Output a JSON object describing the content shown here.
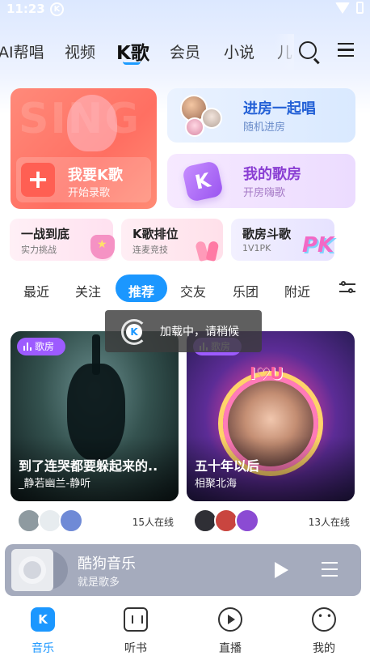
{
  "status": {
    "time": "11:23",
    "app_badge": "K"
  },
  "topnav": {
    "tabs": [
      "AI帮唱",
      "视频",
      "K歌",
      "会员",
      "小说",
      "儿"
    ],
    "active": "K歌"
  },
  "entry": {
    "sing": {
      "deco": "SING",
      "title": "我要K歌",
      "subtitle": "开始录歌"
    },
    "join_room": {
      "title": "进房一起唱",
      "subtitle": "随机进房"
    },
    "my_room": {
      "badge": "K",
      "title": "我的歌房",
      "subtitle": "开房嗨歌"
    }
  },
  "mini_cards": [
    {
      "title": "一战到底",
      "subtitle": "实力挑战"
    },
    {
      "title": "K歌排位",
      "subtitle": "连麦竞技"
    },
    {
      "title": "歌房斗歌",
      "subtitle": "1V1PK",
      "deco": "PK"
    }
  ],
  "filters": {
    "items": [
      "最近",
      "关注",
      "推荐",
      "交友",
      "乐团",
      "附近"
    ],
    "active": "推荐"
  },
  "toast": {
    "logo": "K",
    "message": "加载中，请稍候"
  },
  "posts": [
    {
      "tag": "歌房",
      "title": "到了连哭都要躲起来的..",
      "subtitle": "_静若幽兰-静听",
      "online": "15人在线"
    },
    {
      "tag": "歌房",
      "deco": "I♡U",
      "title": "五十年以后",
      "subtitle": "相聚北海",
      "online": "13人在线"
    }
  ],
  "player": {
    "name": "酷狗音乐",
    "slogan": "就是歌多"
  },
  "bottomnav": [
    {
      "label": "音乐",
      "icon": "k-music-icon",
      "badge": "K",
      "active": true
    },
    {
      "label": "听书",
      "icon": "radio-icon",
      "active": false
    },
    {
      "label": "直播",
      "icon": "live-play-icon",
      "active": false
    },
    {
      "label": "我的",
      "icon": "face-icon",
      "active": false
    }
  ],
  "colors": {
    "accent": "#1b97ff",
    "sing_card": "#ff6f62",
    "room_purple": "#8a3fd3",
    "room_blue": "#2360d6"
  }
}
